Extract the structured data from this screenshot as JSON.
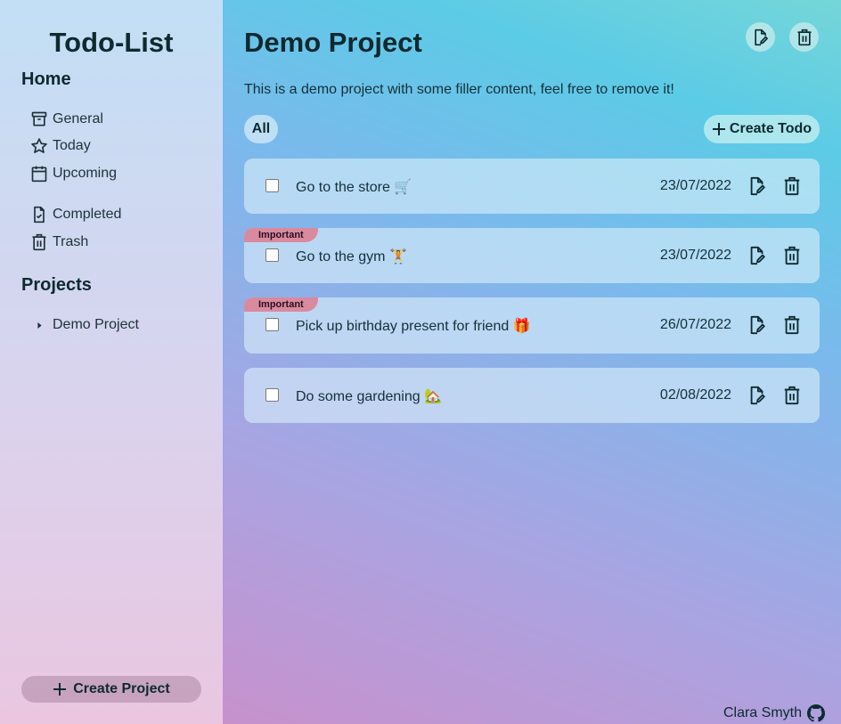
{
  "sidebar": {
    "app_title": "Todo-List",
    "home_heading": "Home",
    "nav": {
      "general": "General",
      "today": "Today",
      "upcoming": "Upcoming",
      "completed": "Completed",
      "trash": "Trash"
    },
    "projects_heading": "Projects",
    "projects": [
      "Demo Project"
    ],
    "create_project_label": "Create Project"
  },
  "main": {
    "title": "Demo Project",
    "description": "This is a demo project with some filler content, feel free to remove it!",
    "filter_label": "All",
    "create_todo_label": "Create Todo",
    "todos": [
      {
        "title": "Go to the store 🛒",
        "date": "23/07/2022",
        "important": false,
        "badge": ""
      },
      {
        "title": "Go to the gym 🏋",
        "date": "23/07/2022",
        "important": true,
        "badge": "Important"
      },
      {
        "title": "Pick up birthday present for friend 🎁",
        "date": "26/07/2022",
        "important": true,
        "badge": "Important"
      },
      {
        "title": "Do some gardening 🏡",
        "date": "02/08/2022",
        "important": false,
        "badge": ""
      }
    ]
  },
  "footer": {
    "author": "Clara Smyth"
  },
  "colors": {
    "text": "#0e2a30",
    "important_badge": "#d98a9e"
  }
}
